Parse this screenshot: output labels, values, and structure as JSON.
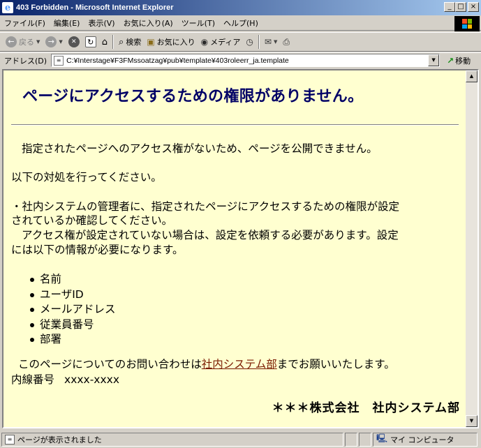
{
  "window": {
    "title": "403 Forbidden - Microsoft Internet Explorer",
    "controls": {
      "minimize": "_",
      "maximize": "□",
      "close": "×"
    }
  },
  "menu": [
    "ファイル(F)",
    "編集(E)",
    "表示(V)",
    "お気に入り(A)",
    "ツール(T)",
    "ヘルプ(H)"
  ],
  "toolbar": {
    "back_label": "戻る",
    "search_label": "検索",
    "favorites_label": "お気に入り",
    "media_label": "メディア"
  },
  "address": {
    "label": "アドレス(D)",
    "value": "C:¥Interstage¥F3FMssoatzag¥pub¥template¥403roleerr_ja.template",
    "go_label": "移動"
  },
  "page": {
    "heading": "ページにアクセスするための権限がありません。",
    "p1": "指定されたページへのアクセス権がないため、ページを公開できません。",
    "p2": "以下の対処を行ってください。",
    "p3_line1": "・社内システムの管理者に、指定されたページにアクセスするための権限が設定",
    "p3_line2": "されているか確認してください。",
    "p3_line3": "アクセス権が設定されていない場合は、設定を依頼する必要があります。設定",
    "p3_line4": "には以下の情報が必要になります。",
    "info_items": [
      "名前",
      "ユーザID",
      "メールアドレス",
      "従業員番号",
      "部署"
    ],
    "contact_before": "このページについてのお問い合わせは",
    "contact_link": "社内システム部",
    "contact_after": "までお願いいたします。",
    "extension_label": "内線番号",
    "extension_value": "xxxx-xxxx",
    "signature": "＊＊＊株式会社　社内システム部"
  },
  "status": {
    "message": "ページが表示されました",
    "zone": "マイ コンピュータ"
  },
  "colors": {
    "page_background": "#ffffd0",
    "heading": "#000066",
    "link": "#7a1a00",
    "titlebar_start": "#0a246a"
  }
}
